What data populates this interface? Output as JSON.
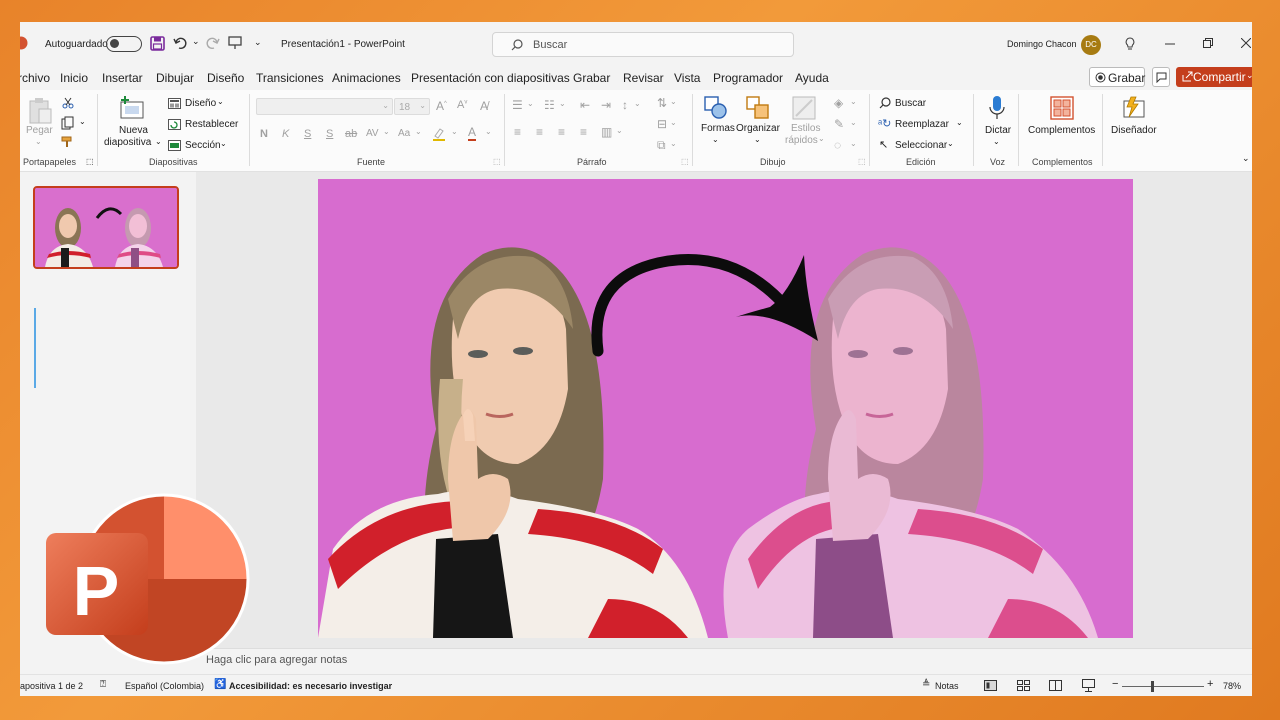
{
  "titlebar": {
    "autosave_label": "Autoguardado",
    "doc_title": "Presentación1  -  PowerPoint",
    "search_placeholder": "Buscar",
    "user_name": "Domingo Chacon",
    "user_initials": "DC"
  },
  "tabs": [
    "rchivo",
    "Inicio",
    "Insertar",
    "Dibujar",
    "Diseño",
    "Transiciones",
    "Animaciones",
    "Presentación con diapositivas",
    "Grabar",
    "Revisar",
    "Vista",
    "Programador",
    "Ayuda"
  ],
  "active_tab": "Inicio",
  "actions": {
    "record_label": "Grabar",
    "share_label": "Compartir"
  },
  "ribbon": {
    "clipboard": {
      "paste": "Pegar",
      "group": "Portapapeles"
    },
    "slides": {
      "new_slide_1": "Nueva",
      "new_slide_2": "diapositiva",
      "layout": "Diseño",
      "reset": "Restablecer",
      "section": "Sección",
      "group": "Diapositivas"
    },
    "font": {
      "size": "18",
      "bold": "N",
      "italic": "K",
      "underline": "S",
      "strike": "S",
      "group": "Fuente"
    },
    "paragraph": {
      "group": "Párrafo"
    },
    "drawing": {
      "shapes": "Formas",
      "arrange": "Organizar",
      "quick_styles_1": "Estilos",
      "quick_styles_2": "rápidos",
      "group": "Dibujo"
    },
    "editing": {
      "find": "Buscar",
      "replace": "Reemplazar",
      "select": "Seleccionar",
      "group": "Edición"
    },
    "voice": {
      "dictate": "Dictar",
      "group": "Voz"
    },
    "addins": {
      "addins": "Complementos",
      "group": "Complementos"
    },
    "designer": {
      "designer": "Diseñador"
    }
  },
  "notes_placeholder": "Haga clic para agregar notas",
  "status": {
    "slide_info": "iapositiva 1 de 2",
    "language": "Español (Colombia)",
    "accessibility": "Accesibilidad: es necesario investigar",
    "notes": "Notas",
    "zoom": "78%"
  },
  "colors": {
    "accent": "#c43e1c",
    "slide_bg": "#d76ccf",
    "logo_orange": "#d35230"
  },
  "icons": [
    "powerpoint-logo-icon",
    "save-icon",
    "undo-icon",
    "redo-icon",
    "search-icon",
    "lightbulb-icon",
    "minimize-icon",
    "restore-icon",
    "close-icon",
    "record-icon",
    "comment-icon",
    "share-icon",
    "microphone-icon",
    "designer-icon",
    "addins-icon",
    "arrow-curve-icon"
  ]
}
